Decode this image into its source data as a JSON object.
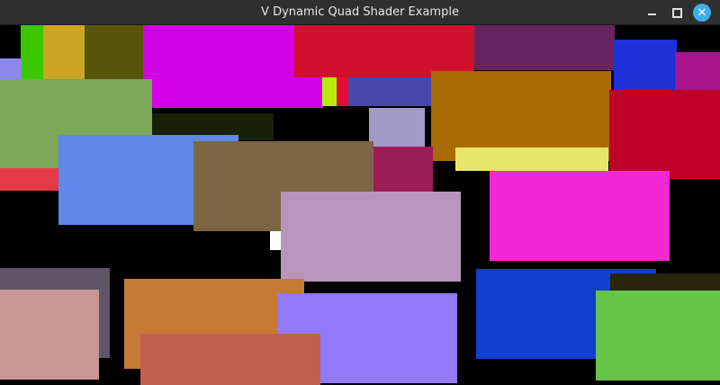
{
  "window": {
    "title": "V Dynamic Quad Shader Example",
    "accent": "#3daee9"
  },
  "controls": {
    "minimize_icon": "minimize-icon",
    "maximize_icon": "maximize-icon",
    "close_icon": "close-icon",
    "close_glyph": "✕"
  },
  "canvas": {
    "background": "#000000",
    "quad_colors": [
      "#3cc800",
      "#cca622",
      "#58540a",
      "#d400e6",
      "#d0102e",
      "#68245f",
      "#1e30d8",
      "#a8158c",
      "#8c88ee",
      "#7ca759",
      "#b7eb0d",
      "#e80a34",
      "#4848a8",
      "#aa6a06",
      "#bf0228",
      "#182006",
      "#a29bc7",
      "#e8e66a",
      "#e63a48",
      "#5e88ea",
      "#7d6544",
      "#9c1c58",
      "#ffffff",
      "#f327d4",
      "#b994be",
      "#5d5566",
      "#c99594",
      "#c67a36",
      "#9179f9",
      "#c25f4b",
      "#1240ce",
      "#27260c",
      "#67c649"
    ]
  }
}
